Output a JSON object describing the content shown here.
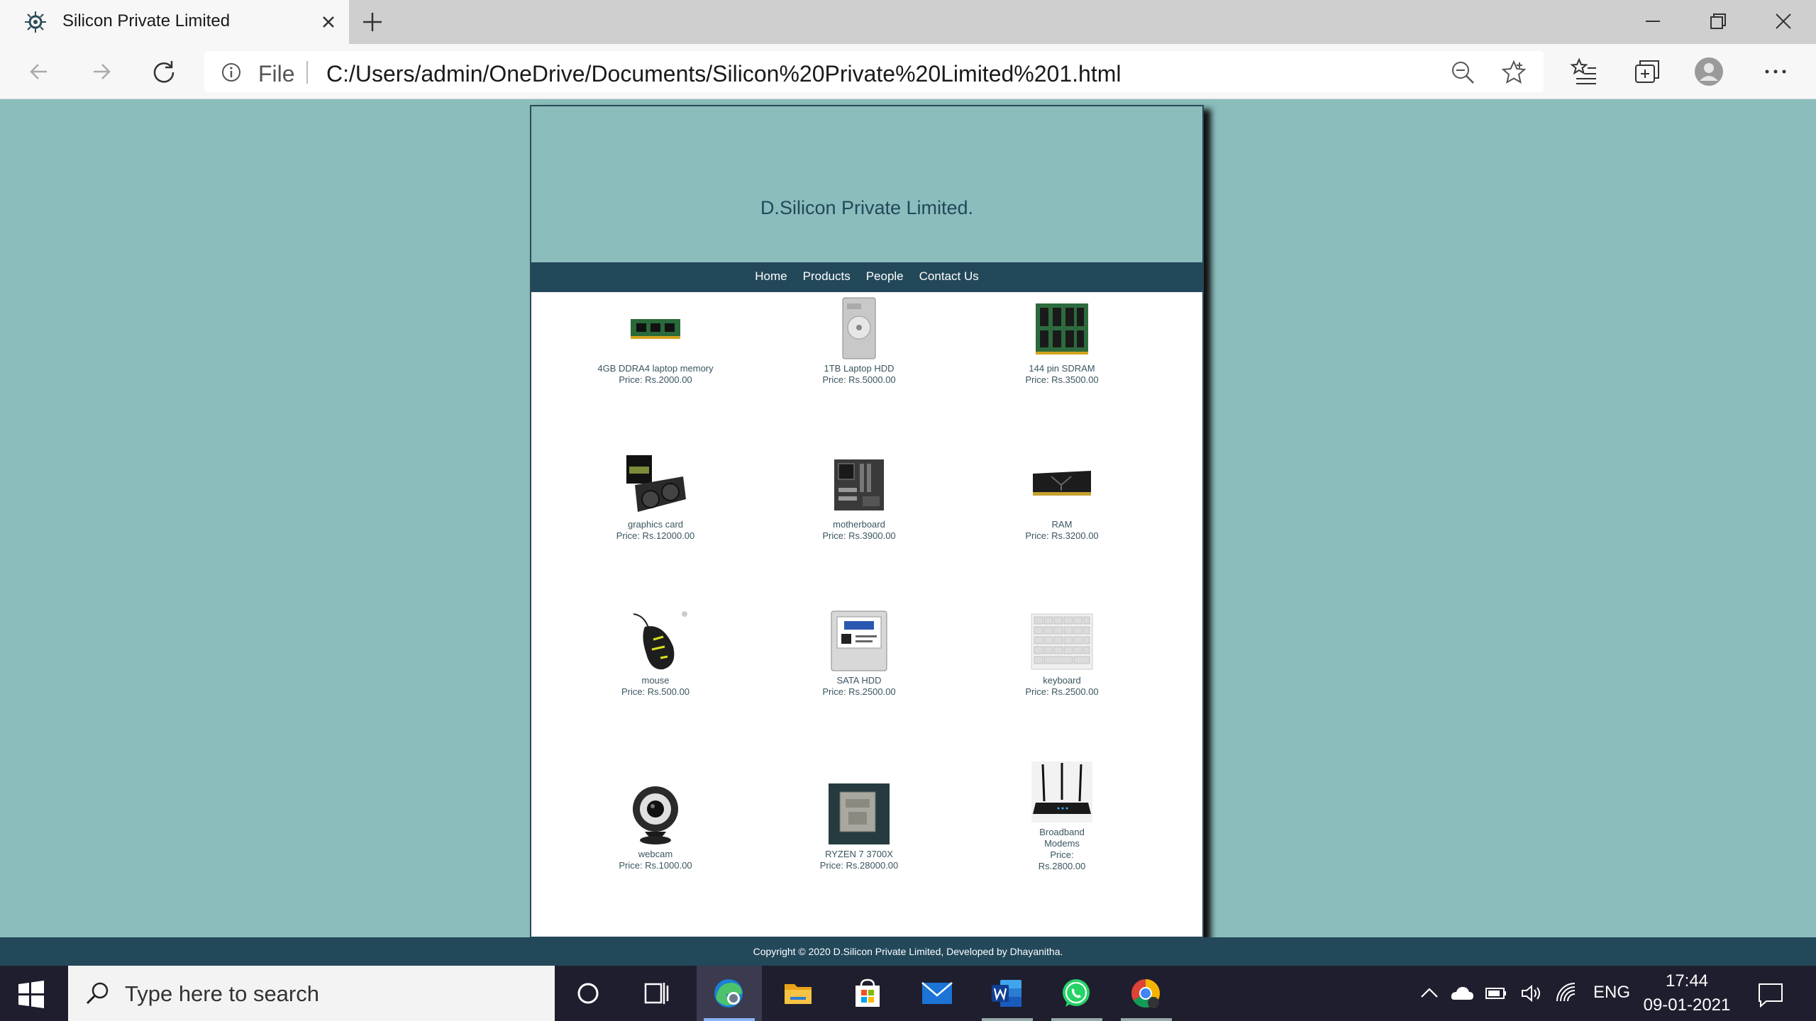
{
  "browser": {
    "tab_title": "Silicon Private Limited",
    "file_label": "File",
    "url": "C:/Users/admin/OneDrive/Documents/Silicon%20Private%20Limited%201.html"
  },
  "site": {
    "title": "D.Silicon Private Limited.",
    "nav": [
      "Home",
      "Products",
      "People",
      "Contact Us"
    ],
    "products": [
      {
        "name": "4GB DDRA4 laptop memory",
        "price": "Price: Rs.2000.00",
        "icon": "ram-stick-icon"
      },
      {
        "name": "1TB Laptop HDD",
        "price": "Price: Rs.5000.00",
        "icon": "laptop-hdd-icon"
      },
      {
        "name": "144 pin SDRAM",
        "price": "Price: Rs.3500.00",
        "icon": "sdram-icon"
      },
      {
        "name": "graphics card",
        "price": "Price: Rs.12000.00",
        "icon": "graphics-card-icon"
      },
      {
        "name": "motherboard",
        "price": "Price: Rs.3900.00",
        "icon": "motherboard-icon"
      },
      {
        "name": "RAM",
        "price": "Price: Rs.3200.00",
        "icon": "ram-module-icon"
      },
      {
        "name": "mouse",
        "price": "Price: Rs.500.00",
        "icon": "mouse-icon"
      },
      {
        "name": "SATA HDD",
        "price": "Price: Rs.2500.00",
        "icon": "sata-hdd-icon"
      },
      {
        "name": "keyboard",
        "price": "Price: Rs.2500.00",
        "icon": "keyboard-icon"
      },
      {
        "name": "webcam",
        "price": "Price: Rs.1000.00",
        "icon": "webcam-icon"
      },
      {
        "name": "RYZEN 7 3700X",
        "price": "Price: Rs.28000.00",
        "icon": "cpu-icon"
      },
      {
        "name": "Broadband Modems",
        "price": "Price: Rs.2800.00",
        "icon": "router-icon"
      }
    ],
    "footer": "Copyright © 2020 D.Silicon Private Limited, Developed by Dhayanitha."
  },
  "taskbar": {
    "search_placeholder": "Type here to search",
    "language": "ENG",
    "time": "17:44",
    "date": "09-01-2021"
  }
}
